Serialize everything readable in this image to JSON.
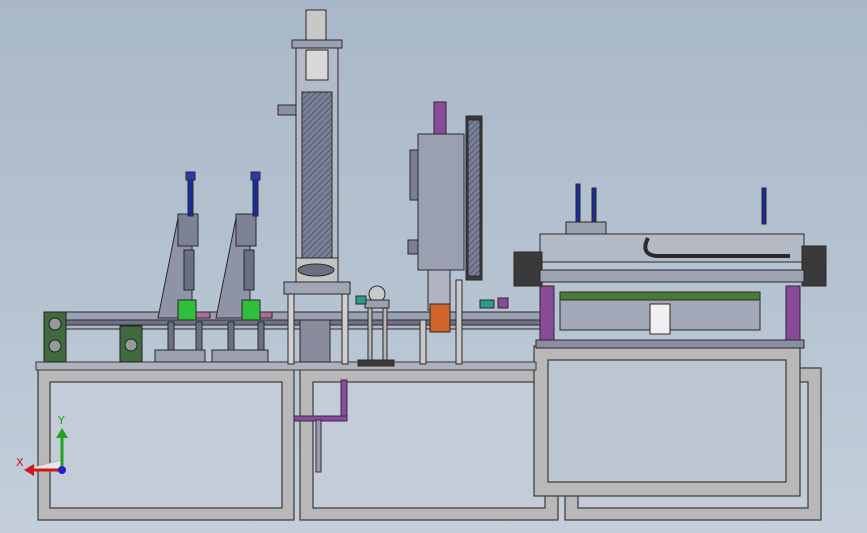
{
  "view": {
    "background_top": "#a9b8c8",
    "background_bottom": "#c4cfdb"
  },
  "triad": {
    "y_label": "Y",
    "x_label": "X",
    "y_color": "#1fa31f",
    "x_color": "#d01818",
    "z_color": "#2020c8"
  },
  "palette": {
    "frame": "#b8b8b8",
    "frame_edge": "#3a3a3a",
    "steel": "#8c8fa8",
    "cylinder_blue": "#1a2a9a",
    "green_part": "#2fbf3a",
    "purple_part": "#8a4a9a",
    "orange_part": "#d0642a"
  }
}
